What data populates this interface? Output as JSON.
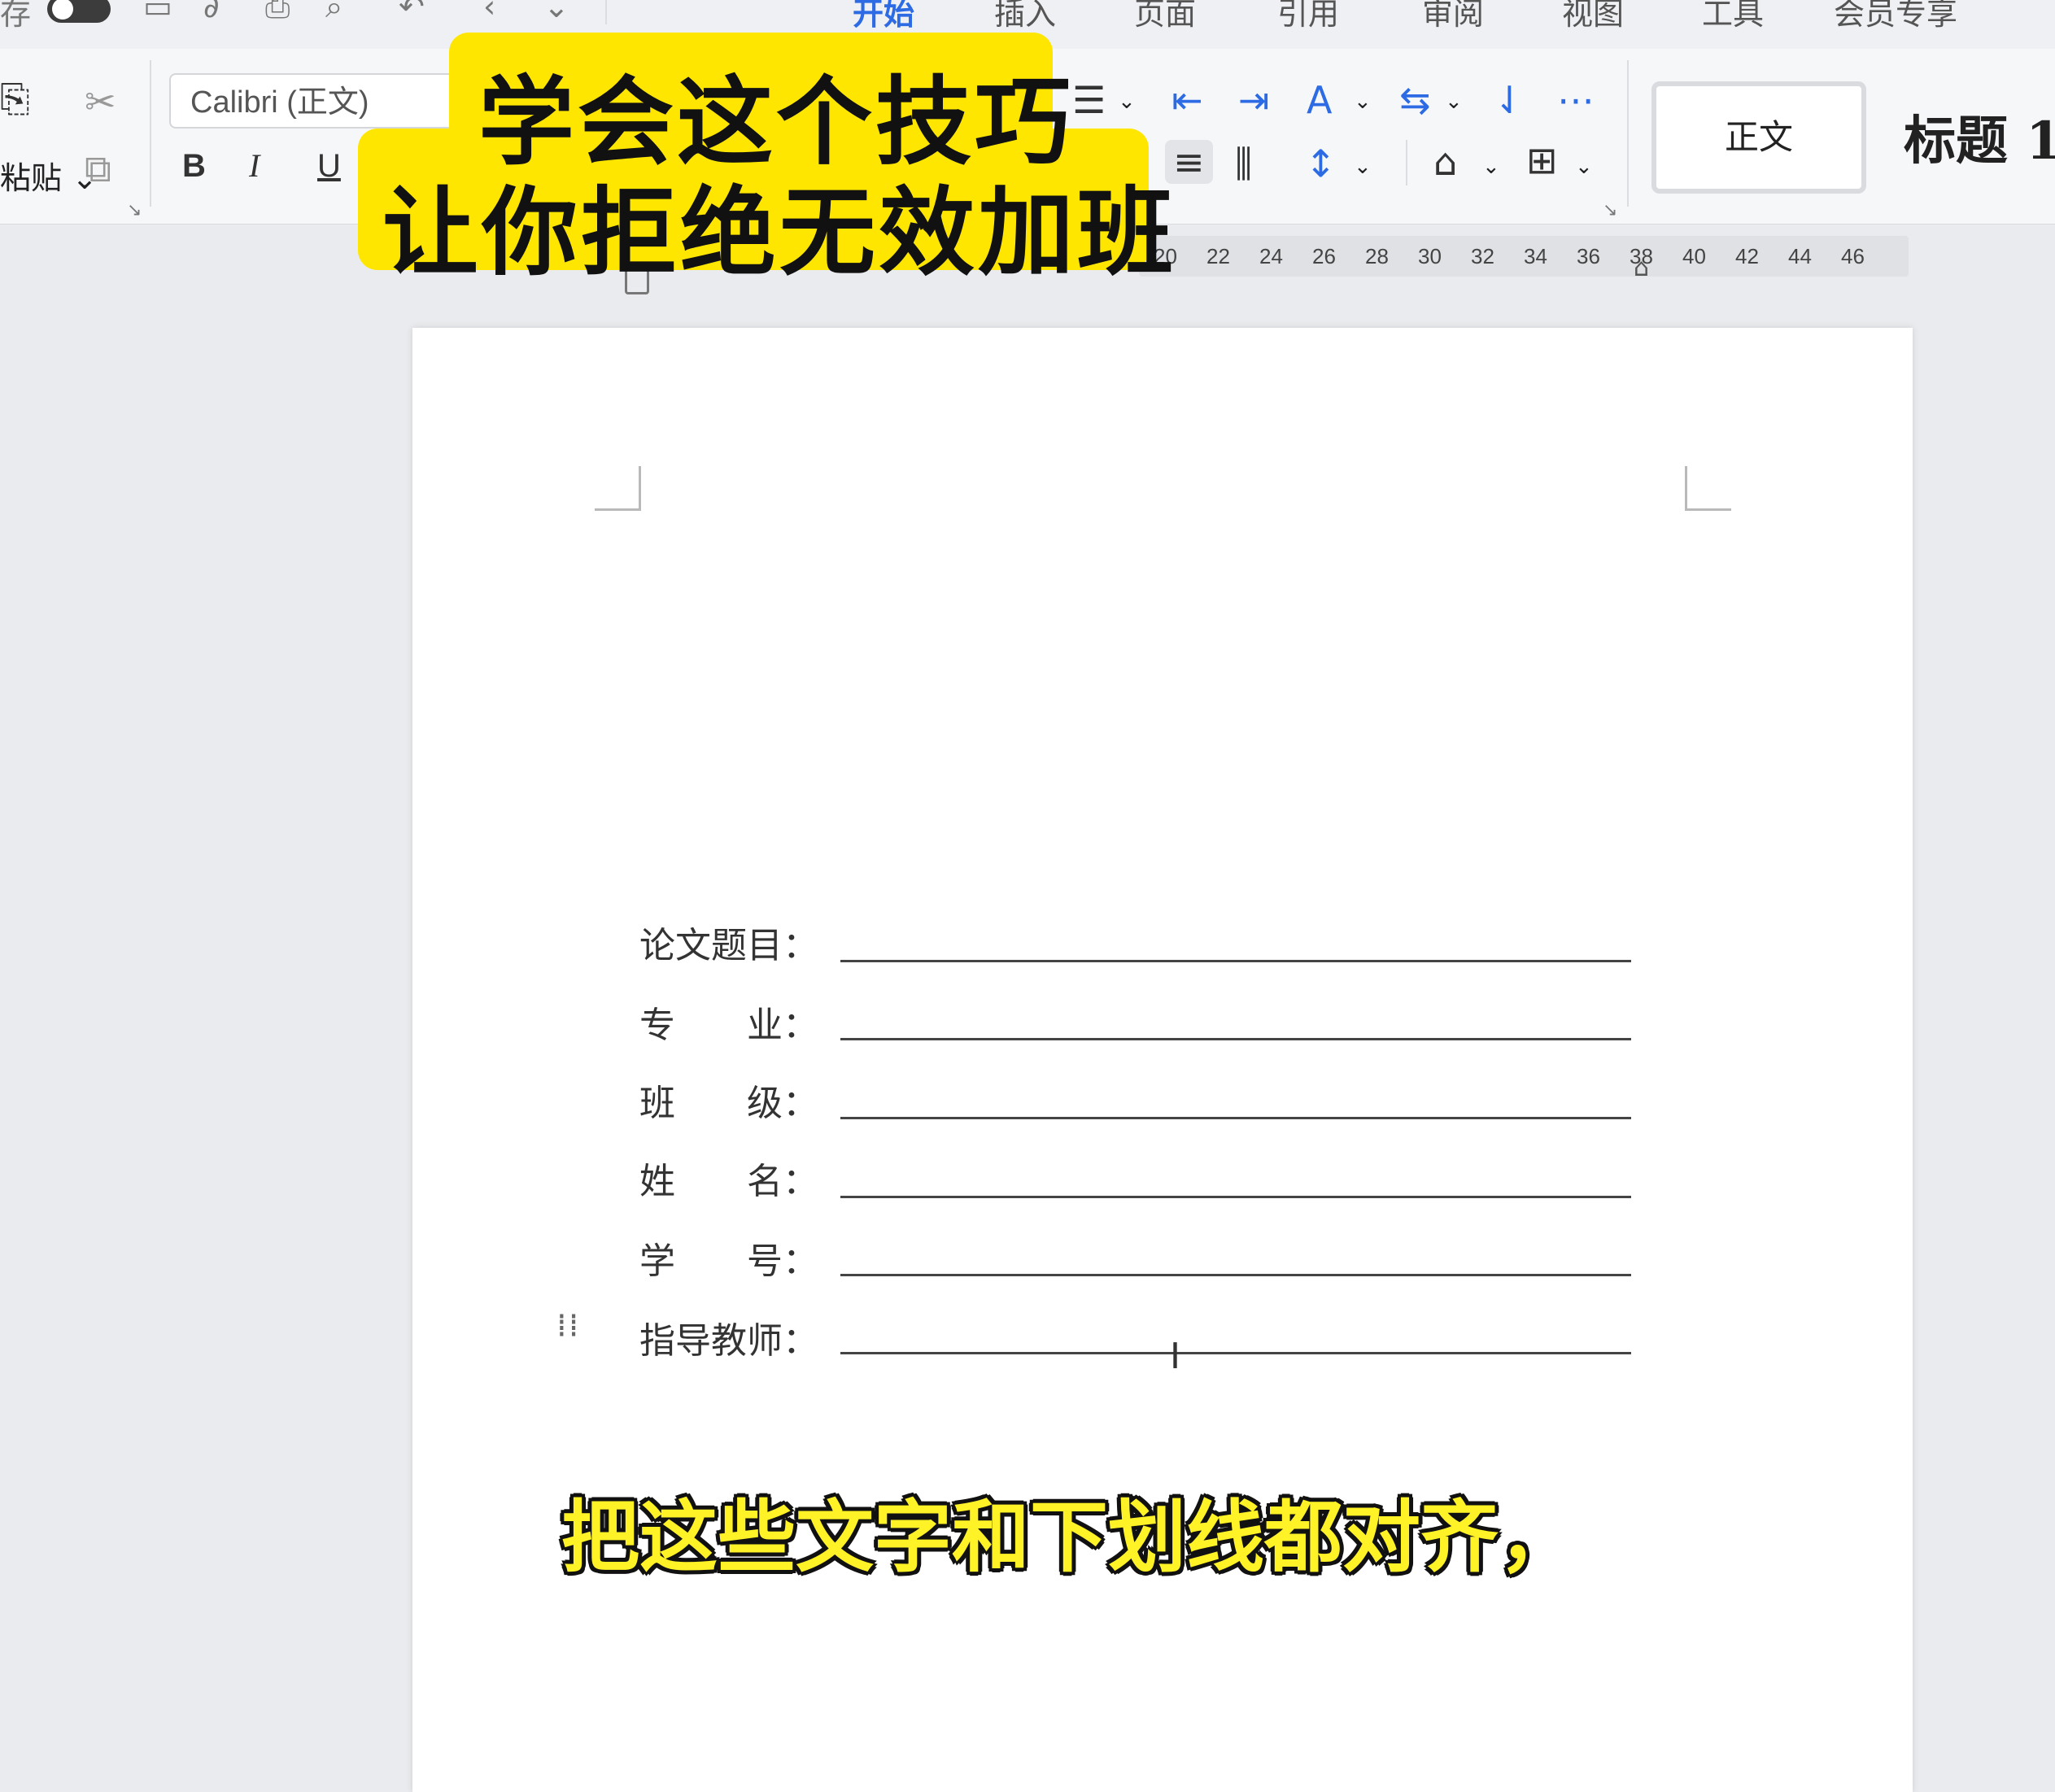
{
  "topbar": {
    "left_label": "存",
    "tabs": [
      "开始",
      "插入",
      "页面",
      "引用",
      "审阅",
      "视图",
      "工具",
      "会员专享"
    ],
    "active_tab": "开始"
  },
  "ribbon": {
    "paste_label": "粘贴",
    "font_name": "Calibri (正文)",
    "bold": "B",
    "italic": "I",
    "underline": "U",
    "style_normal": "正文",
    "style_heading": "标题 1"
  },
  "ruler": {
    "ticks": [
      "20",
      "22",
      "24",
      "26",
      "28",
      "30",
      "32",
      "34",
      "36",
      "38",
      "40",
      "42",
      "44",
      "46"
    ]
  },
  "document": {
    "fields": [
      {
        "label": "论文题目：",
        "value": ""
      },
      {
        "label": "专　　业：",
        "value": ""
      },
      {
        "label": "班　　级：",
        "value": ""
      },
      {
        "label": "姓　　名：",
        "value": ""
      },
      {
        "label": "学　　号：",
        "value": ""
      },
      {
        "label": "指导教师：",
        "value": ""
      }
    ]
  },
  "overlay": {
    "banner_line1": "学会这个技巧",
    "banner_line2": "让你拒绝无效加班",
    "subtitle": "把这些文字和下划线都对齐，"
  },
  "colors": {
    "accent": "#2d6be4",
    "banner": "#ffe600",
    "subtitle": "#fff226"
  }
}
